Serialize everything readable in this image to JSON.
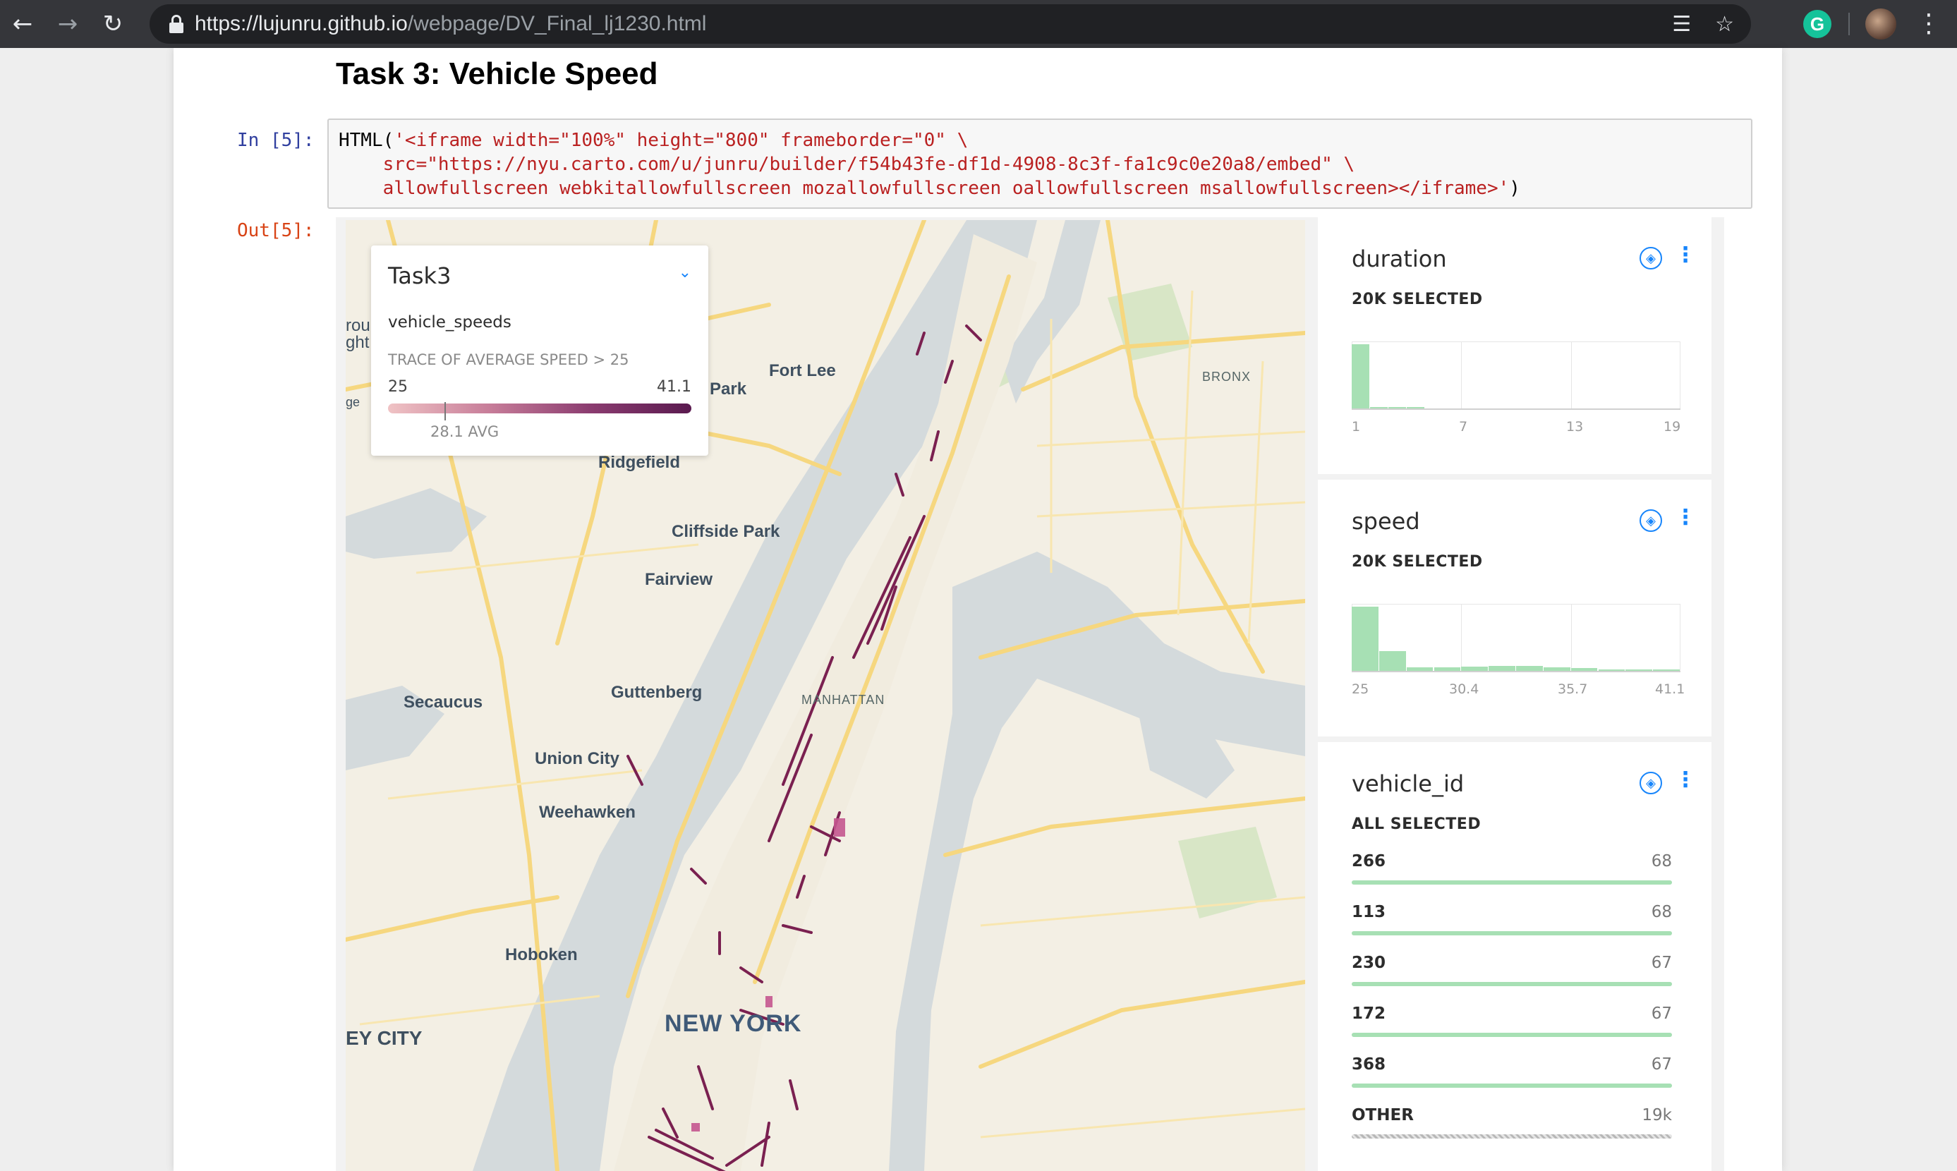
{
  "browser": {
    "url_host": "https://lujunru.github.io",
    "url_path": "/webpage/DV_Final_lj1230.html",
    "icons": [
      "back-arrow-icon",
      "forward-arrow-icon",
      "reload-icon",
      "lock-icon",
      "translate-icon",
      "star-icon",
      "grammarly-icon",
      "avatar",
      "kebab-menu-icon"
    ],
    "extension_letter": "G"
  },
  "notebook": {
    "heading": "Task 3: Vehicle Speed",
    "in_prompt": "In [5]:",
    "out_prompt": "Out[5]:",
    "code": {
      "line1_prefix": "HTML(",
      "line1_str": "'<iframe width=\"100%\" height=\"800\" frameborder=\"0\" \\",
      "line2_str": "    src=\"https://nyu.carto.com/u/junru/builder/f54b43fe-df1d-4908-8c3f-fa1c9c0e20a8/embed\" \\",
      "line3_str": "    allowfullscreen webkitallowfullscreen mozallowfullscreen oallowfullscreen msallowfullscreen></iframe>'",
      "line3_suffix": ")"
    }
  },
  "map": {
    "labels": {
      "fort_lee": "Fort Lee",
      "park": "Park",
      "bronx": "BRONX",
      "ridgefield": "Ridgefield",
      "cliffside_park": "Cliffside Park",
      "fairview": "Fairview",
      "guttenberg": "Guttenberg",
      "manhattan": "MANHATTAN",
      "secaucus": "Secaucus",
      "union_city": "Union City",
      "weehawken": "Weehawken",
      "hoboken": "Hoboken",
      "new_york": "NEW YORK",
      "jersey_city": "EY CITY",
      "cut_1": "rou",
      "cut_2": "ght",
      "cut_3": "ge"
    },
    "legend": {
      "title": "Task3",
      "layer": "vehicle_speeds",
      "trace": "TRACE OF AVERAGE SPEED > 25",
      "min": "25",
      "max": "41.1",
      "avg_label": "28.1 AVG",
      "avg_value": 28.1,
      "ramp_colors": [
        "#f0c3c5",
        "#c77d99",
        "#8b3c70",
        "#5a1a4f"
      ]
    },
    "trace_color": "#7a2050"
  },
  "widgets": {
    "duration": {
      "title": "duration",
      "status": "20K SELECTED",
      "ticks": [
        "1",
        "7",
        "13",
        "19"
      ],
      "bins": [
        1.0,
        0.03,
        0.02,
        0.01,
        0,
        0,
        0,
        0,
        0,
        0,
        0,
        0,
        0,
        0,
        0,
        0,
        0,
        0
      ]
    },
    "speed": {
      "title": "speed",
      "status": "20K SELECTED",
      "ticks": [
        "25",
        "30.4",
        "35.7",
        "41.1"
      ],
      "bins": [
        1.0,
        0.32,
        0.06,
        0.07,
        0.08,
        0.09,
        0.09,
        0.07,
        0.05,
        0.03,
        0.02,
        0.02
      ]
    },
    "vehicle_id": {
      "title": "vehicle_id",
      "status": "ALL SELECTED",
      "items": [
        {
          "label": "266",
          "value": "68",
          "fill": 1.0
        },
        {
          "label": "113",
          "value": "68",
          "fill": 1.0
        },
        {
          "label": "230",
          "value": "67",
          "fill": 1.0
        },
        {
          "label": "172",
          "value": "67",
          "fill": 1.0
        },
        {
          "label": "368",
          "value": "67",
          "fill": 1.0
        },
        {
          "label": "OTHER",
          "value": "19k",
          "fill": 1.0
        }
      ]
    }
  },
  "accent_color": "#1785fb",
  "histogram_color": "#a7e0b4"
}
